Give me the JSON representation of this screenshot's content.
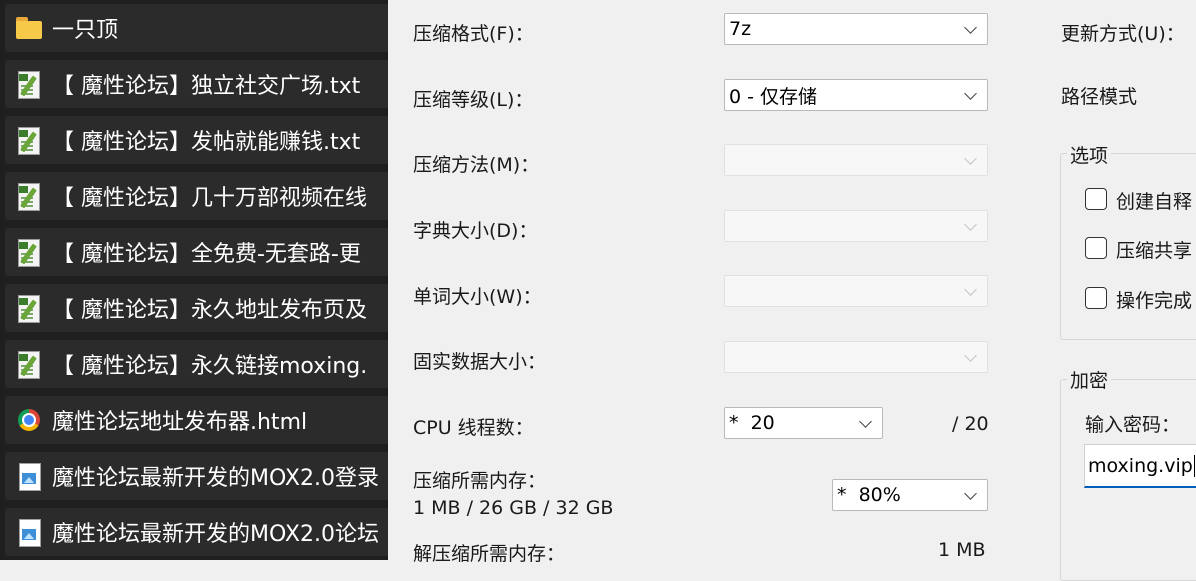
{
  "file_list": {
    "items": [
      {
        "name": "一只顶",
        "icon": "folder-icon"
      },
      {
        "name": "【 魔性论坛】独立社交广场.txt",
        "icon": "text-file-icon"
      },
      {
        "name": "【 魔性论坛】发帖就能赚钱.txt",
        "icon": "text-file-icon"
      },
      {
        "name": "【 魔性论坛】几十万部视频在线",
        "icon": "text-file-icon"
      },
      {
        "name": "【 魔性论坛】全免费-无套路-更",
        "icon": "text-file-icon"
      },
      {
        "name": "【 魔性论坛】永久地址发布页及",
        "icon": "text-file-icon"
      },
      {
        "name": "【 魔性论坛】永久链接moxing.",
        "icon": "text-file-icon"
      },
      {
        "name": "魔性论坛地址发布器.html",
        "icon": "chrome-html-icon"
      },
      {
        "name": "魔性论坛最新开发的MOX2.0登录",
        "icon": "image-file-icon"
      },
      {
        "name": "魔性论坛最新开发的MOX2.0论坛",
        "icon": "image-file-icon"
      }
    ]
  },
  "dialog": {
    "format": {
      "label": "压缩格式(F)：",
      "value": "7z"
    },
    "level": {
      "label": "压缩等级(L)：",
      "value": "0 - 仅存储"
    },
    "method": {
      "label": "压缩方法(M)：",
      "value": ""
    },
    "dict_size": {
      "label": "字典大小(D)：",
      "value": ""
    },
    "word_size": {
      "label": "单词大小(W)：",
      "value": ""
    },
    "solid_size": {
      "label": "固实数据大小：",
      "value": ""
    },
    "threads": {
      "label": "CPU 线程数：",
      "value": "*  20",
      "max": "/ 20"
    },
    "memory": {
      "label": "压缩所需内存：",
      "detail": "1 MB / 26 GB / 32 GB",
      "value": "*  80%"
    },
    "decompress_memory": {
      "label": "解压缩所需内存：",
      "value": "1 MB"
    },
    "update_mode": {
      "label": "更新方式(U)："
    },
    "path_mode": {
      "label": "路径模式"
    },
    "options": {
      "title": "选项",
      "items": [
        "创建自释",
        "压缩共享",
        "操作完成"
      ]
    },
    "encryption": {
      "title": "加密",
      "password_label": "输入密码：",
      "password_value": "moxing.vip"
    }
  },
  "colors": {
    "list_bg": "#1f1f1f",
    "row_bg": "#2b2b2b",
    "dialog_bg": "#f0f0f0",
    "accent": "#005fb8"
  }
}
